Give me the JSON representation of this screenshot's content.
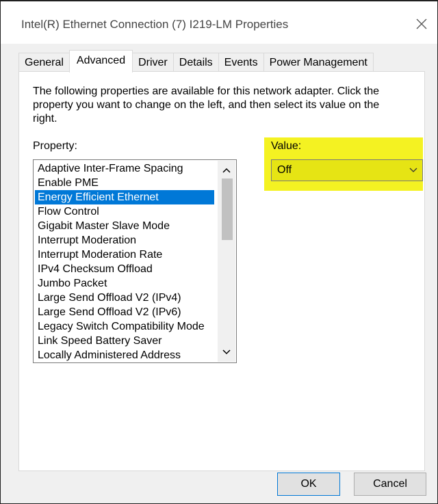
{
  "window": {
    "title": "Intel(R) Ethernet Connection (7) I219-LM Properties"
  },
  "tabs": [
    {
      "label": "General"
    },
    {
      "label": "Advanced"
    },
    {
      "label": "Driver"
    },
    {
      "label": "Details"
    },
    {
      "label": "Events"
    },
    {
      "label": "Power Management"
    }
  ],
  "active_tab": "Advanced",
  "panel": {
    "description": "The following properties are available for this network adapter. Click the property you want to change on the left, and then select its value on the right.",
    "property_label": "Property:",
    "value_label": "Value:",
    "properties": [
      "Adaptive Inter-Frame Spacing",
      "Enable PME",
      "Energy Efficient Ethernet",
      "Flow Control",
      "Gigabit Master Slave Mode",
      "Interrupt Moderation",
      "Interrupt Moderation Rate",
      "IPv4 Checksum Offload",
      "Jumbo Packet",
      "Large Send Offload V2 (IPv4)",
      "Large Send Offload V2 (IPv6)",
      "Legacy Switch Compatibility Mode",
      "Link Speed Battery Saver",
      "Locally Administered Address"
    ],
    "selected_property": "Energy Efficient Ethernet",
    "value": "Off"
  },
  "buttons": {
    "ok": "OK",
    "cancel": "Cancel"
  },
  "colors": {
    "selection": "#0078d7",
    "highlight": "#f4f222"
  },
  "icons": {
    "close": "close-icon",
    "scroll_up": "chevron-up-icon",
    "scroll_down": "chevron-down-icon",
    "dropdown": "chevron-down-icon"
  }
}
